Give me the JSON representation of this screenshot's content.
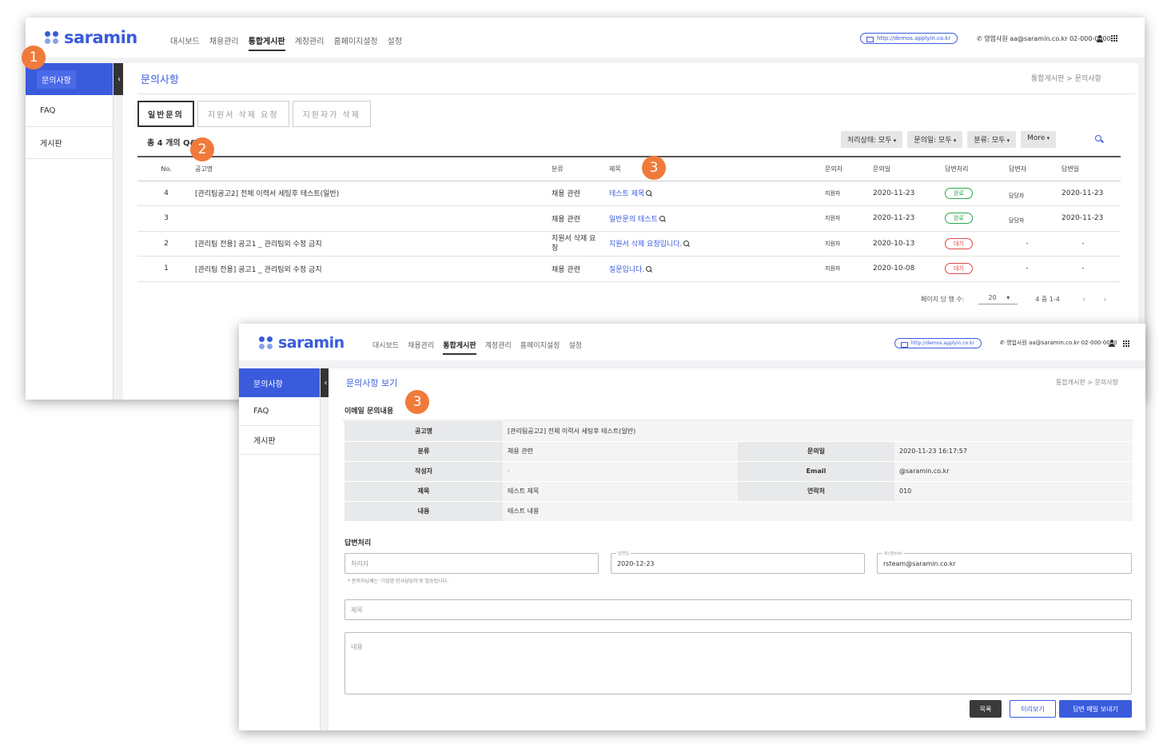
{
  "brand": {
    "logo_text": "saramin",
    "accent": "#3a5bdc"
  },
  "nav": [
    "대시보드",
    "채용관리",
    "통합게시판",
    "계정관리",
    "홈페이지설정",
    "설정"
  ],
  "header": {
    "url": "http://demos.applyin.co.kr",
    "user": "영업사원 aa@saramin.co.kr 02-000-0000"
  },
  "sidebar": [
    "문의사항",
    "FAQ",
    "게시판"
  ],
  "list_page": {
    "title": "문의사항",
    "breadcrumb": "통합게시판 > 문의사항",
    "tabs": [
      "일반문의",
      "지원서 삭제 요청",
      "지원자가 삭제"
    ],
    "count": "총 4 개의 Q&A",
    "filters": [
      "처리상태: 모두",
      "문의일: 모두",
      "분류: 모두",
      "More"
    ],
    "columns": [
      "No.",
      "공고명",
      "분류",
      "제목",
      "문의자",
      "문의일",
      "답변처리",
      "답변자",
      "답변일"
    ],
    "rows": [
      {
        "no": "4",
        "posting": "[관리팀공고2] 전체 이력서 세팅후 테스트(일반)",
        "category": "채용 관련",
        "title": "테스트 제목",
        "asker": "지원자",
        "date": "2020-11-23",
        "status": "완료",
        "answerer": "담당자",
        "adate": "2020-11-23"
      },
      {
        "no": "3",
        "posting": "",
        "category": "채용 관련",
        "title": "일반문의 테스트",
        "asker": "지원자",
        "date": "2020-11-23",
        "status": "완료",
        "answerer": "담당자",
        "adate": "2020-11-23"
      },
      {
        "no": "2",
        "posting": "[관리팀 전용] 공고1 _ 관리팀외 수정 금지",
        "category": "지원서 삭제 요청",
        "title": "지원서 삭제 요청입니다.",
        "asker": "지원자",
        "date": "2020-10-13",
        "status": "대기",
        "answerer": "-",
        "adate": "-"
      },
      {
        "no": "1",
        "posting": "[관리팀 전용] 공고1 _ 관리팀외 수정 금지",
        "category": "채용 관련",
        "title": "질문입니다.",
        "asker": "지원자",
        "date": "2020-10-08",
        "status": "대기",
        "answerer": "-",
        "adate": "-"
      }
    ],
    "pager": {
      "per_page_label": "페이지 당 행 수:",
      "per_page": "20",
      "range": "4 중 1-4",
      "prev": "‹",
      "next": "›"
    }
  },
  "detail_page": {
    "title": "문의사항 보기",
    "breadcrumb": "통합게시판 > 문의사항",
    "section": "이메일 문의내용",
    "labels": {
      "posting": "공고명",
      "category": "분류",
      "date": "문의일",
      "author": "작성자",
      "email": "Email",
      "subject": "제목",
      "phone": "연락처",
      "content": "내용"
    },
    "values": {
      "posting": "[관리팀공고2] 전체 이력서 세팅후 테스트(일반)",
      "category": "채용 관련",
      "date": "2020-11-23 16:17:57",
      "author": "·",
      "email": "@saramin.co.kr",
      "subject": "테스트 제목",
      "phone": "010",
      "content": "테스트 내용"
    },
    "answer_section": "답변처리",
    "handler_placeholder": "처리자",
    "answer_date_label": "답변일",
    "answer_date": "2020-12-23",
    "reply_email_label": "회신Email",
    "reply_email": "rsteam@saramin.co.kr",
    "note": "* 문의자님께는 '기업명 인사담당자'로 발송됩니다.",
    "subject_placeholder": "제목",
    "content_placeholder": "내용",
    "buttons": {
      "list": "목록",
      "preview": "미리보기",
      "send": "답변 메일 보내기"
    }
  },
  "markers": [
    "1",
    "2",
    "3",
    "3"
  ],
  "collapse_icon": "‹",
  "colors": {
    "done": "#2aa84a",
    "wait": "#e04848",
    "marker": "#f07a3a"
  }
}
